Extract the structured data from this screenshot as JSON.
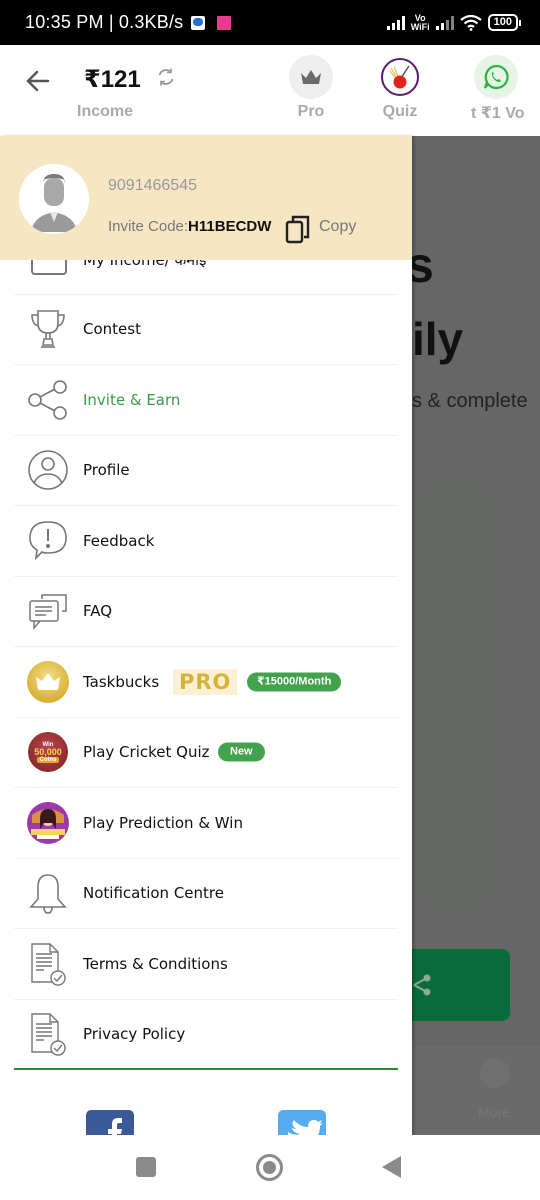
{
  "status_bar": {
    "time_speed": "10:35 PM | 0.3KB/s",
    "vowifi_top": "Vo",
    "vowifi_bottom": "WiFi",
    "battery": "100"
  },
  "header": {
    "balance": "₹121",
    "balance_label": "Income",
    "actions": [
      {
        "label": "Pro",
        "icon": "crown-icon"
      },
      {
        "label": "Quiz",
        "icon": "cricket-ball-icon"
      },
      {
        "label": "t ₹1 Vo",
        "icon": "whatsapp-icon"
      }
    ]
  },
  "drawer": {
    "profile": {
      "phone": "9091466545",
      "invite_code_label": "Invite Code:",
      "invite_code": "H11BECDW",
      "copy_label": "Copy"
    },
    "partial_item_label": "My Income/ कमाई",
    "items": [
      {
        "label": "Contest",
        "icon": "trophy-icon"
      },
      {
        "label": "Invite & Earn",
        "icon": "share-icon",
        "highlight": true
      },
      {
        "label": "Profile",
        "icon": "user-circle-icon"
      },
      {
        "label": "Feedback",
        "icon": "feedback-icon"
      },
      {
        "label": "FAQ",
        "icon": "faq-chat-icon"
      },
      {
        "label": "Taskbucks",
        "icon": "taskbucks-crown-icon",
        "badge": "PRO",
        "pill": "₹15000/Month"
      },
      {
        "label": "Play Cricket Quiz",
        "icon": "cricket-quiz-icon",
        "pill": "New",
        "icon_text_top": "Win",
        "icon_text_mid": "50,000",
        "icon_text_bot": "Coins"
      },
      {
        "label": "Play Prediction & Win",
        "icon": "prediction-icon"
      },
      {
        "label": "Notification Centre",
        "icon": "bell-icon"
      },
      {
        "label": "Terms & Conditions",
        "icon": "document-check-icon"
      },
      {
        "label": "Privacy Policy",
        "icon": "document-check-icon"
      }
    ],
    "social": [
      "facebook",
      "twitter"
    ]
  },
  "background": {
    "heading_fragment_1": "s",
    "heading_fragment_2": "ily",
    "sub_fragment": "s & complete",
    "nav_more_label": "More"
  },
  "colors": {
    "accent_green": "#3d9b48",
    "drawer_header_bg": "#f7e6c3",
    "pill_green": "#43a34c",
    "pro_gold": "#d6b43b"
  }
}
